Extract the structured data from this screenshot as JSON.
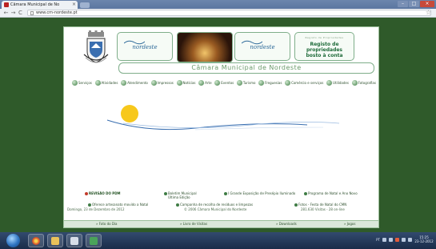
{
  "browser": {
    "tab_title": "Câmara Municipal de No",
    "tab_close": "×",
    "url": "www.cm-nordeste.pt",
    "back": "←",
    "forward": "→",
    "reload": "C",
    "bookmark_star": "☆",
    "min": "–",
    "max": "□",
    "close": "×"
  },
  "site": {
    "banner_left": "nordeste",
    "banner_right": "nordeste",
    "register_small": "Registo de Propriedades",
    "register_line1": "Registo de propriedades",
    "register_line2": "bosto à conta",
    "title": "Câmara Municipal de Nordeste",
    "nav": [
      "Serviços",
      "Atividades",
      "Atendimento",
      "Impressos",
      "Notícias",
      "Arte",
      "Eventos",
      "Turismo",
      "Freguesias",
      "Comércio e serviços",
      "Utilidades",
      "Fotografias"
    ],
    "news": {
      "col1_title": "REVISÃO DO PDM",
      "col1_item": "Oferece artesanato movido a Natal",
      "col1_date": "Domingo, 23 de Dezembro de 2012",
      "col2_title": "Boletim Municipal",
      "col2_sub": "Última Edição",
      "col2_item": "Campanha de recolha de resíduos e limpezas",
      "col2_copy": "© 2006 Câmara Municipal do Nordeste",
      "col3_item": "I Grande Exposição de Presépio Iluminado",
      "col4_item": "Programa de Natal e Ano Novo",
      "col4_sub": "Fotos - Festa de Natal do CMN",
      "col4_visits": "281.630 Visitas - 28 on-line"
    },
    "bottom_nav": [
      "» Foto do Dia",
      "» Livro de Visitas",
      "» Downloads",
      "» Jogos"
    ]
  },
  "taskbar": {
    "lang": "PT",
    "time": "15:25",
    "date": "23-12-2012"
  },
  "colors": {
    "page_bg": "#2f5a2a",
    "accent_green": "#3f7c45",
    "title_green": "#6a9a6a"
  }
}
